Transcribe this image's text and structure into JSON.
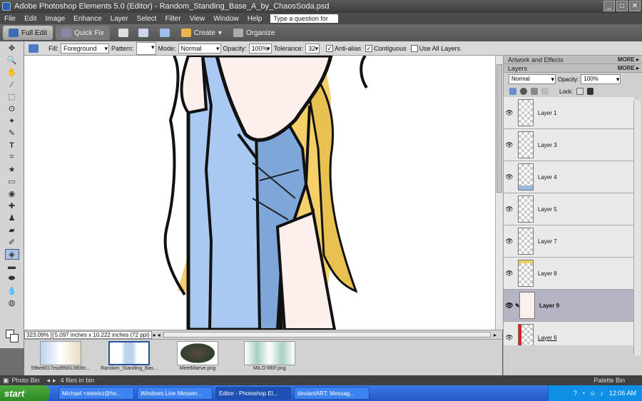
{
  "window": {
    "title": "Adobe Photoshop Elements 5.0 (Editor) - Random_Standing_Base_A_by_ChaosSoda.psd",
    "controls": [
      "_",
      "□",
      "✕"
    ]
  },
  "menu": {
    "items": [
      "File",
      "Edit",
      "Image",
      "Enhance",
      "Layer",
      "Select",
      "Filter",
      "View",
      "Window",
      "Help"
    ],
    "help_placeholder": "Type a question for help"
  },
  "shortcuts": {
    "full_edit": "Full Edit",
    "quick_fix": "Quick Fix",
    "create": "Create",
    "organize": "Organize"
  },
  "options": {
    "fill_label": "Fill:",
    "fill_value": "Foreground",
    "pattern_label": "Pattern:",
    "mode_label": "Mode:",
    "mode_value": "Normal",
    "opacity_label": "Opacity:",
    "opacity_value": "100%",
    "tolerance_label": "Tolerance:",
    "tolerance_value": "32",
    "antialias": "Anti-alias",
    "contiguous": "Contiguous",
    "use_all_layers": "Use All Layers"
  },
  "status": {
    "zoom": "323.09%",
    "doc_size": "5.097 inches x 10.222 inches (72 ppi)"
  },
  "photobin": {
    "items": [
      "59be8017ead96813808c...",
      "Random_Standing_Bas...",
      "MeetMaeve.png",
      "MILO REF.png"
    ]
  },
  "palettes": {
    "artwork": "Artwork and Effects",
    "layers": "Layers",
    "more": "MORE ▸",
    "blend": "Normal",
    "opacity_label": "Opacity:",
    "opacity_value": "100%",
    "lock_label": "Lock:"
  },
  "layers": [
    "Layer 1",
    "Layer 3",
    "Layer 4",
    "Layer 5",
    "Layer 7",
    "Layer 8",
    "Layer 9",
    "Layer 6"
  ],
  "bin": {
    "photo_bin": "Photo Bin",
    "count": "4 files in bin",
    "palette_bin": "Palette Bin"
  },
  "taskbar": {
    "start": "start",
    "tasks": [
      "Michael <steelxz@ho...",
      "Windows Live Messen...",
      "Editor - Photoshop El...",
      "deviantART: Messag..."
    ],
    "time": "12:06 AM"
  }
}
